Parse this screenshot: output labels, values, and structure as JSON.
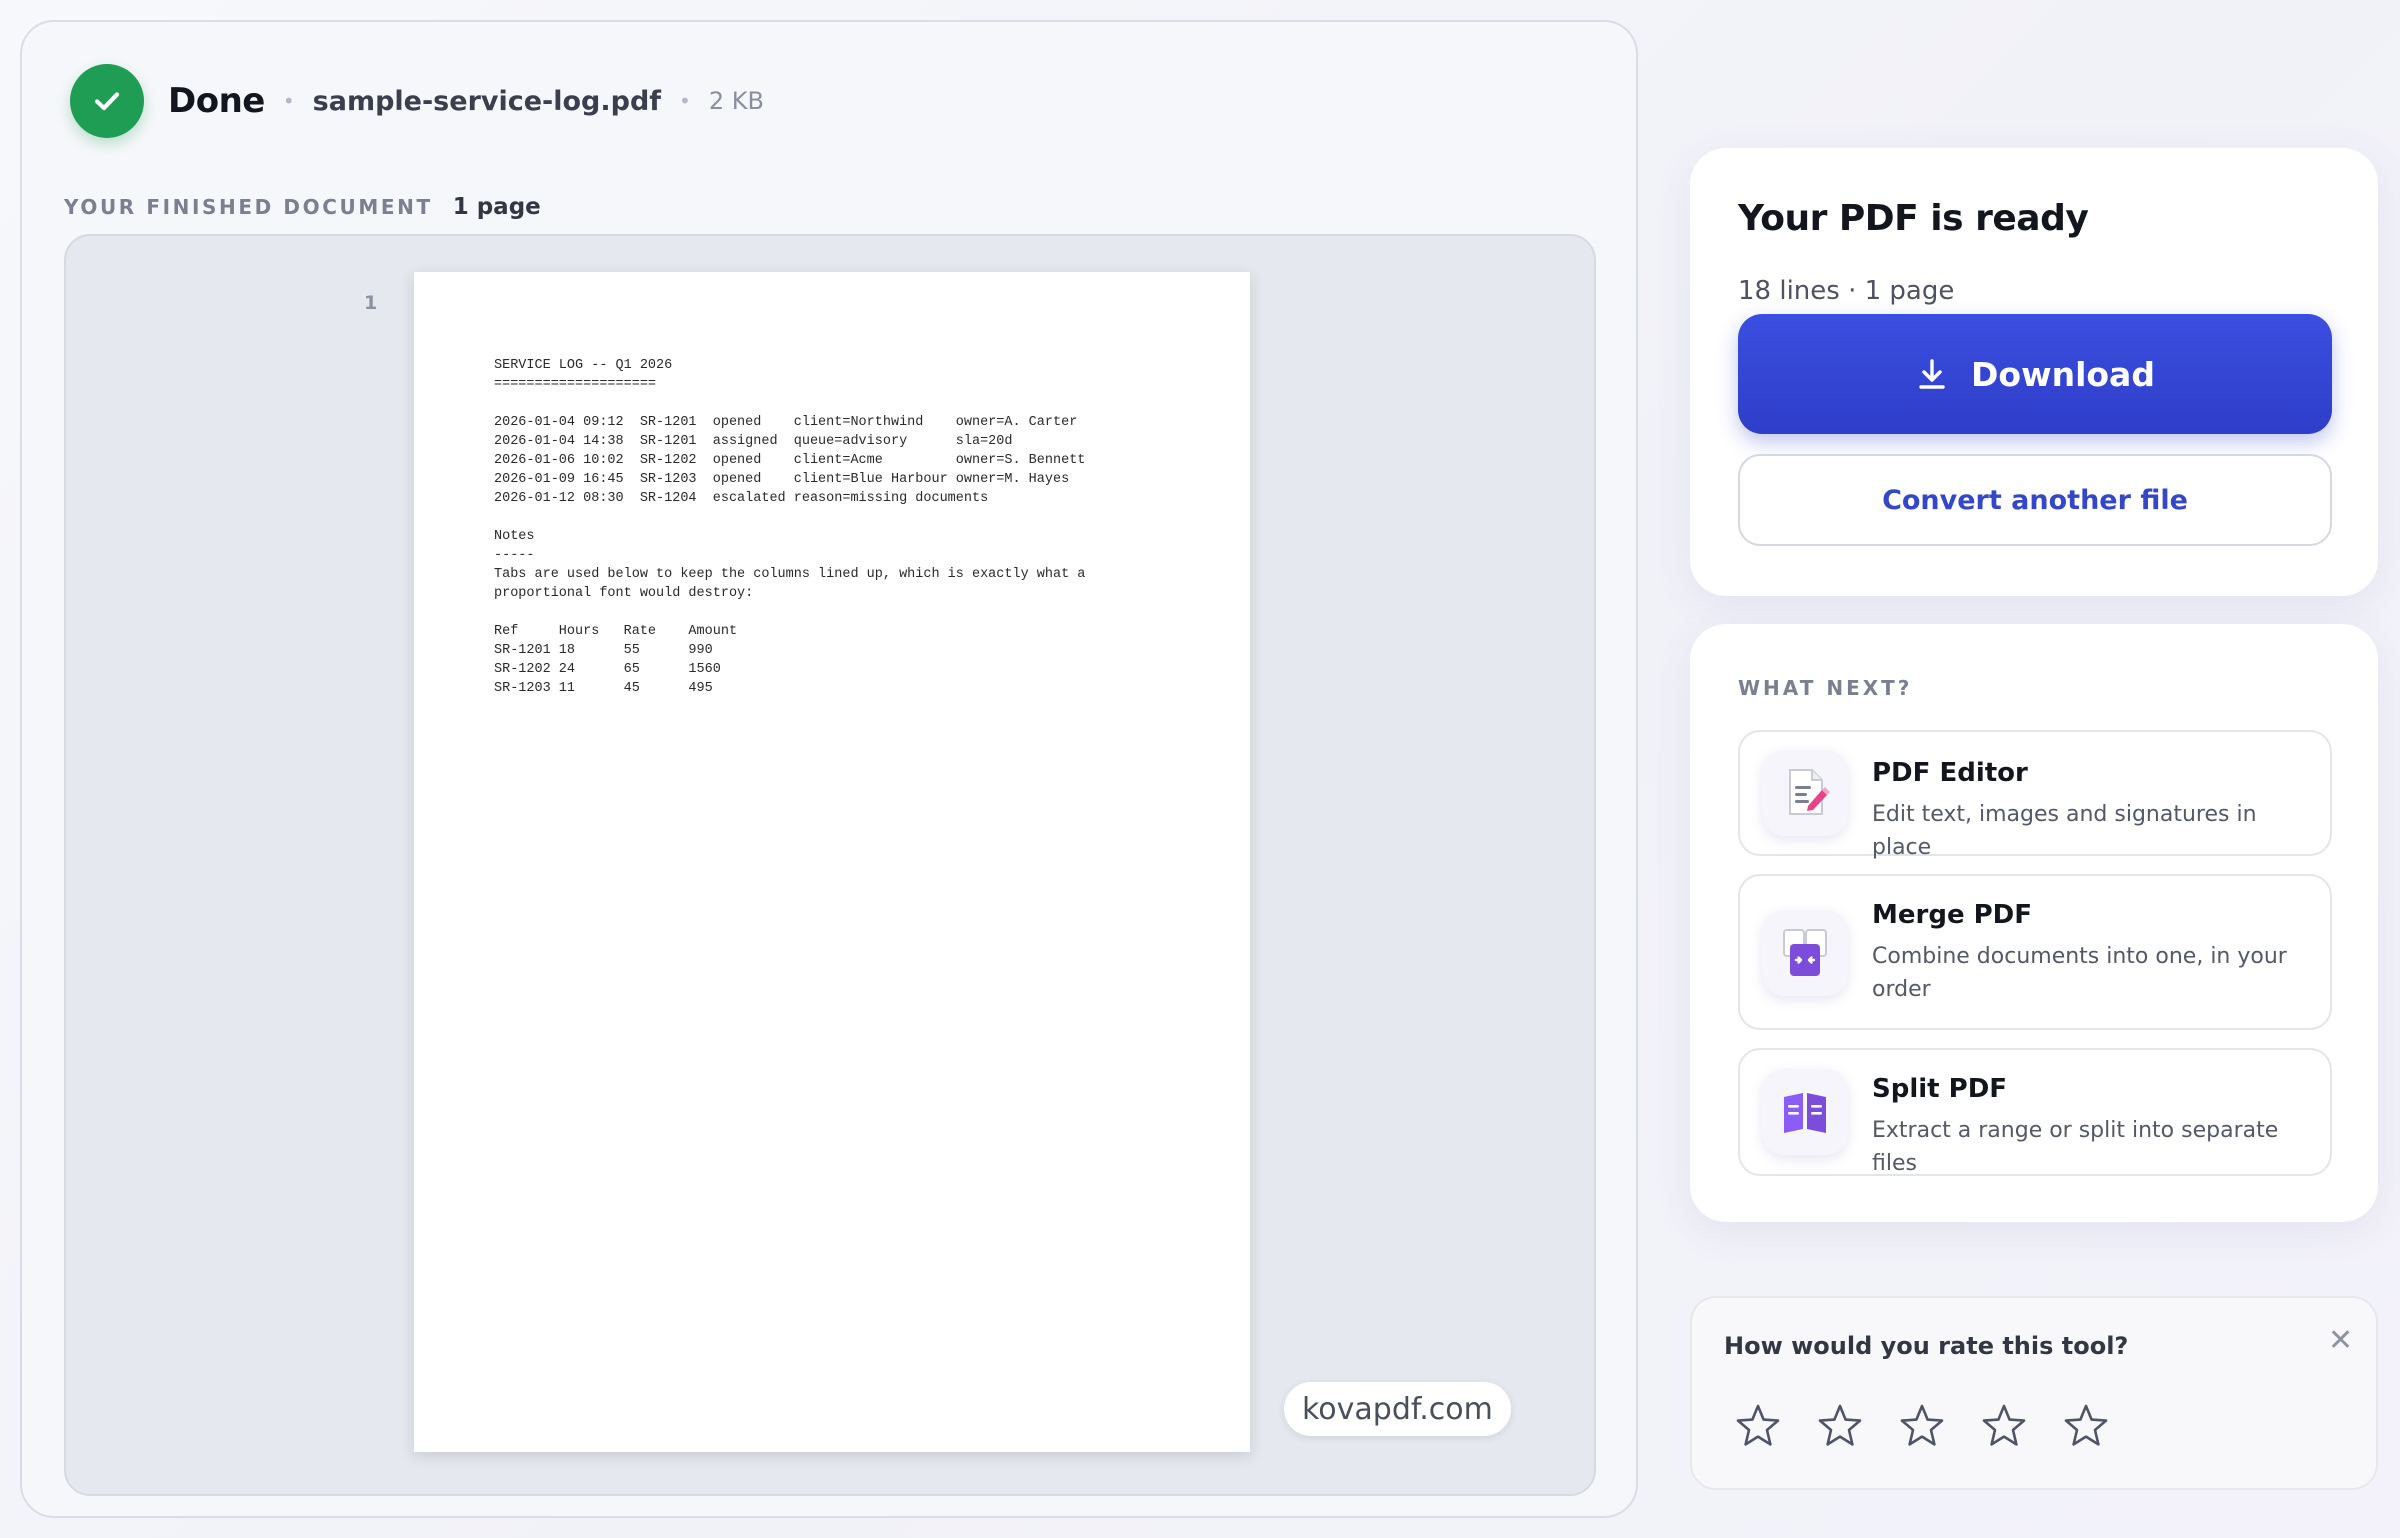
{
  "status": {
    "label": "Done",
    "file_name": "sample-service-log.pdf",
    "file_size": "2 KB"
  },
  "document": {
    "section_label": "YOUR FINISHED DOCUMENT",
    "page_count": "1 page",
    "page_number": "1",
    "content": "SERVICE LOG -- Q1 2026\n====================\n\n2026-01-04 09:12  SR-1201  opened    client=Northwind    owner=A. Carter\n2026-01-04 14:38  SR-1201  assigned  queue=advisory      sla=20d\n2026-01-06 10:02  SR-1202  opened    client=Acme         owner=S. Bennett\n2026-01-09 16:45  SR-1203  opened    client=Blue Harbour owner=M. Hayes\n2026-01-12 08:30  SR-1204  escalated reason=missing documents\n\nNotes\n-----\nTabs are used below to keep the columns lined up, which is exactly what a\nproportional font would destroy:\n\nRef     Hours   Rate    Amount\nSR-1201 18      55      990\nSR-1202 24      65      1560\nSR-1203 11      45      495",
    "watermark": "kovapdf.com"
  },
  "ready": {
    "title": "Your PDF is ready",
    "subtitle": "18 lines · 1 page",
    "download_label": "Download",
    "convert_label": "Convert another file"
  },
  "next": {
    "label": "WHAT NEXT?",
    "tools": [
      {
        "title": "PDF Editor",
        "description": "Edit text, images and signatures in place",
        "icon": "pdf-editor-icon"
      },
      {
        "title": "Merge PDF",
        "description": "Combine documents into one, in your order",
        "icon": "merge-pdf-icon"
      },
      {
        "title": "Split PDF",
        "description": "Extract a range or split into separate files",
        "icon": "split-pdf-icon"
      }
    ]
  },
  "rating": {
    "question": "How would you rate this tool?",
    "close_icon": "close-icon",
    "max_stars": 5,
    "selected": 0
  },
  "colors": {
    "success": "#1f9d55",
    "primary": "#2e3ec9",
    "link": "#3446c9"
  }
}
